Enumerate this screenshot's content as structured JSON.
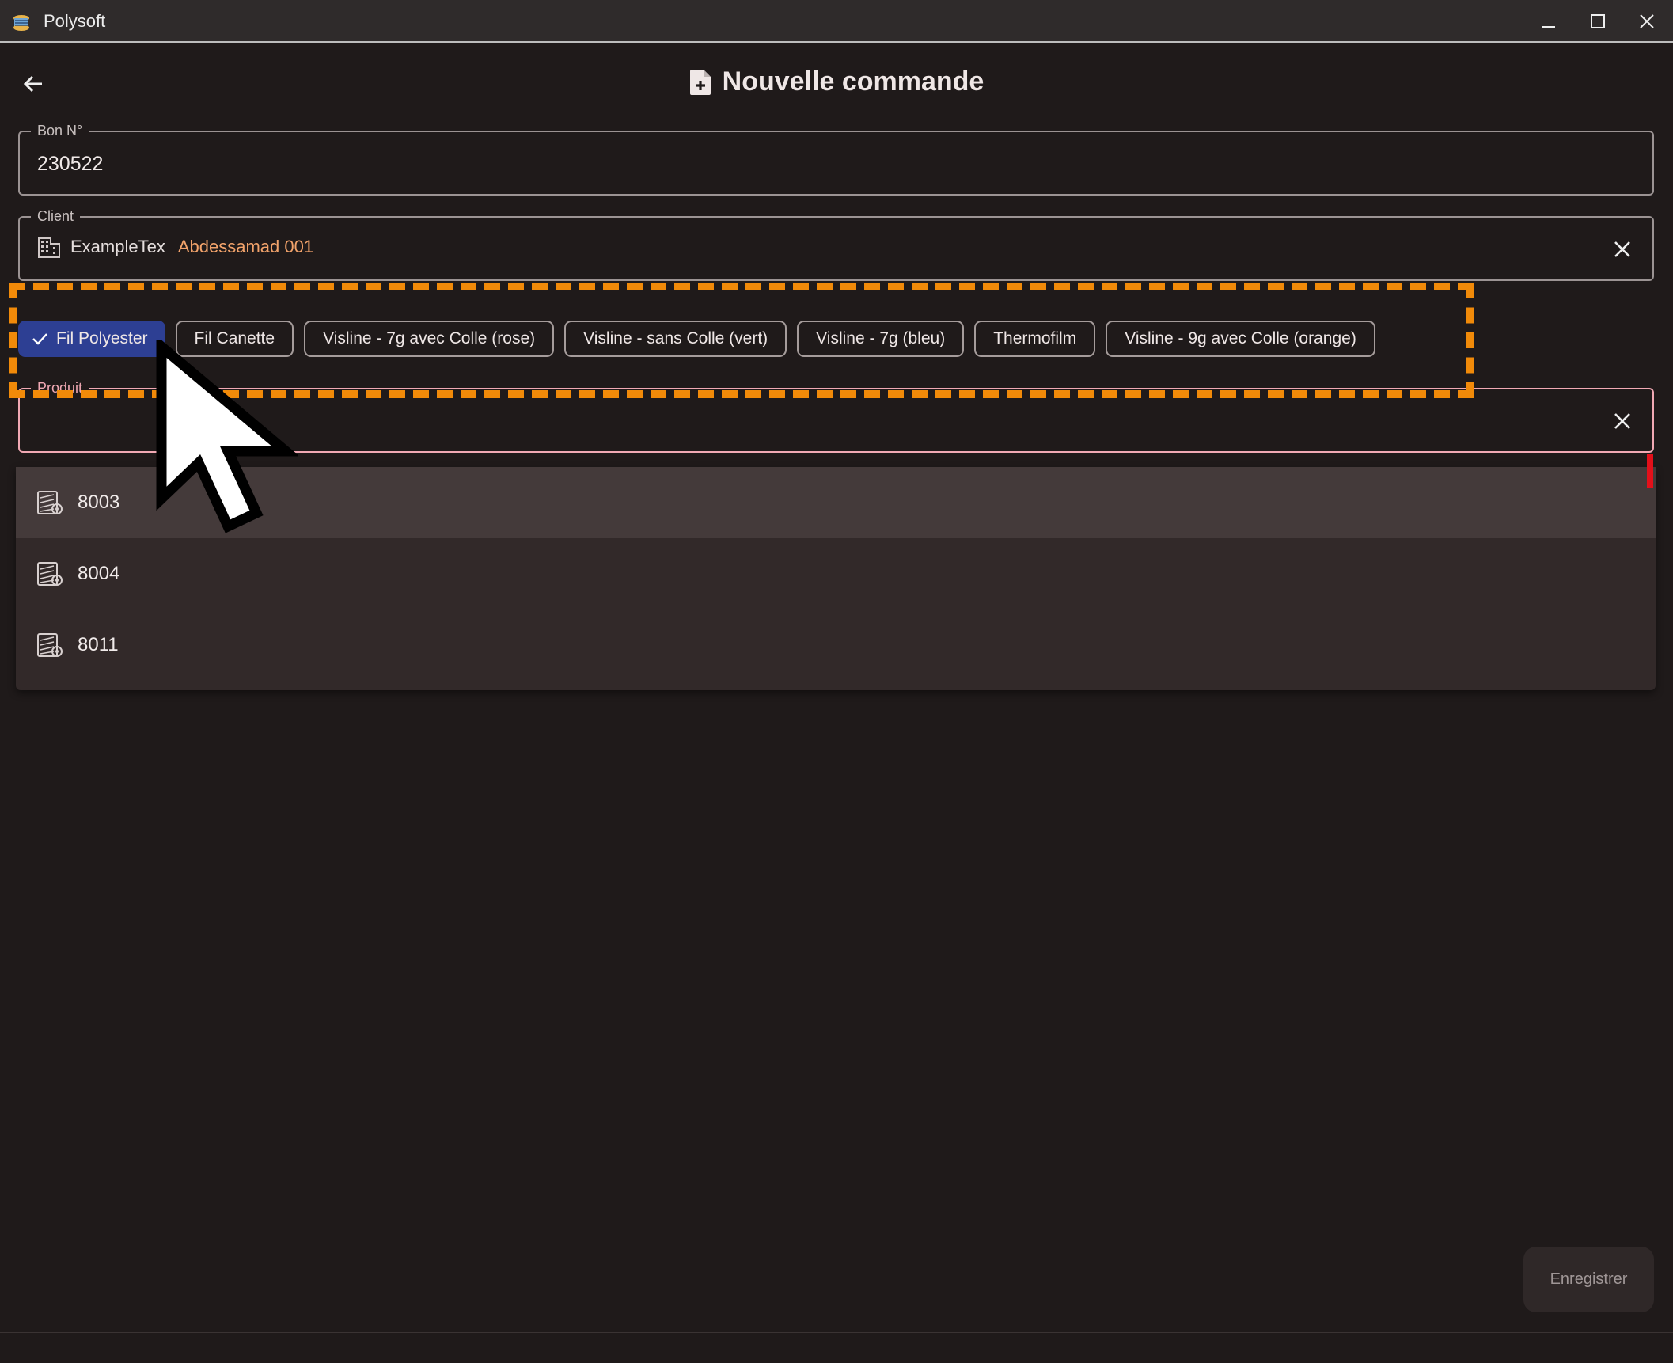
{
  "window": {
    "title": "Polysoft",
    "controls": [
      "minimize",
      "maximize",
      "close"
    ]
  },
  "header": {
    "back_icon": "arrow-left-icon",
    "title_icon": "document-add-icon",
    "title": "Nouvelle commande"
  },
  "bon": {
    "label": "Bon N°",
    "value": "230522"
  },
  "client": {
    "label": "Client",
    "icon": "building-icon",
    "name": "ExampleTex",
    "contact": "Abdessamad 001"
  },
  "categories": [
    {
      "label": "Fil Polyester",
      "selected": true
    },
    {
      "label": "Fil Canette",
      "selected": false
    },
    {
      "label": "Visline - 7g avec Colle (rose)",
      "selected": false
    },
    {
      "label": "Visline - sans Colle (vert)",
      "selected": false
    },
    {
      "label": "Visline - 7g (bleu)",
      "selected": false
    },
    {
      "label": "Thermofilm",
      "selected": false
    },
    {
      "label": "Visline - 9g avec Colle (orange)",
      "selected": false
    }
  ],
  "produit": {
    "label": "Produit",
    "value": "",
    "options": [
      {
        "label": "8003",
        "icon": "thread-spool-icon",
        "highlighted": true
      },
      {
        "label": "8004",
        "icon": "thread-spool-icon",
        "highlighted": false
      },
      {
        "label": "8011",
        "icon": "thread-spool-icon",
        "highlighted": false
      }
    ]
  },
  "actions": {
    "save_label": "Enregistrer"
  },
  "colors": {
    "background": "#1f1a1a",
    "selected_chip": "#2d3f93",
    "client_contact": "#f2a36b",
    "produit_border": "#f1a9b4",
    "annotation": "#f18a09"
  }
}
